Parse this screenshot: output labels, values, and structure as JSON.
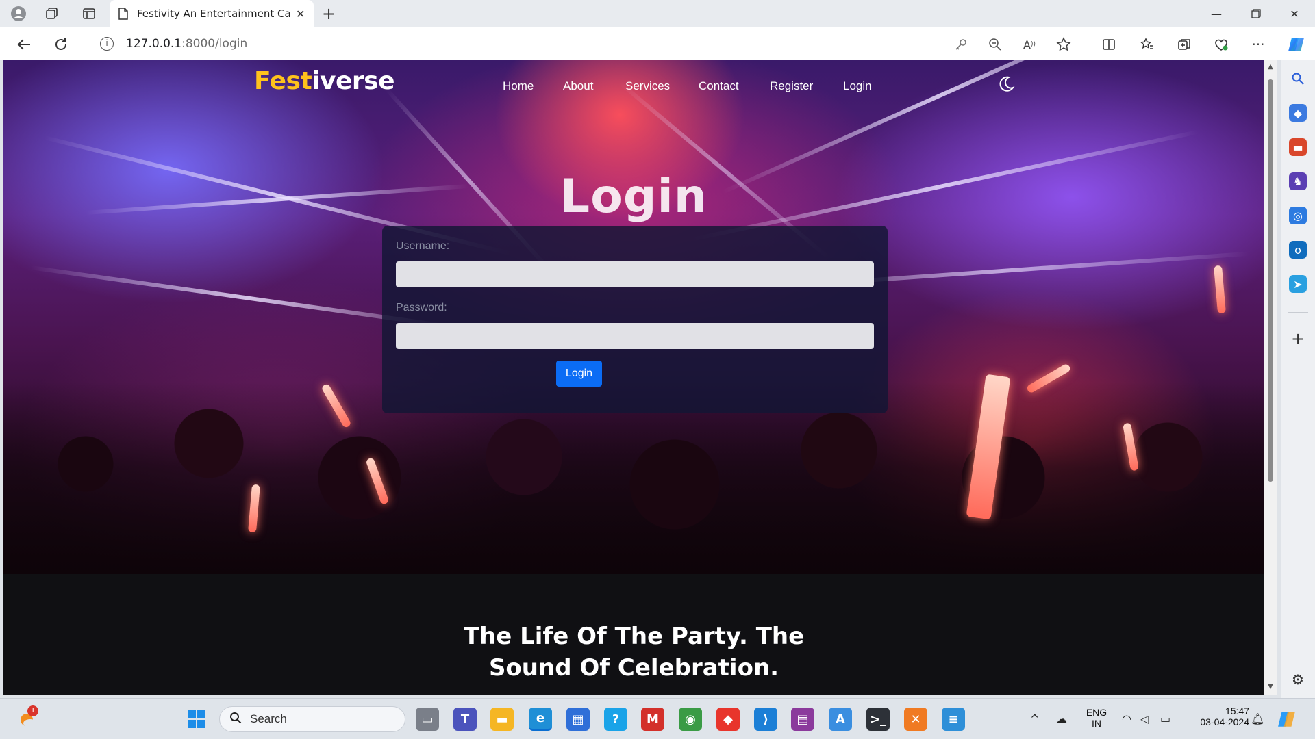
{
  "browser": {
    "tab_title": "Festivity An Entertainment Categ",
    "url_host": "127.0.0.1",
    "url_path": ":8000/login"
  },
  "site": {
    "logo_part1": "Fest",
    "logo_part2": "iverse",
    "nav": [
      "Home",
      "About",
      "Services",
      "Contact",
      "Register",
      "Login"
    ]
  },
  "login": {
    "title": "Login",
    "username_label": "Username:",
    "password_label": "Password:",
    "username_value": "",
    "password_value": "",
    "button_label": "Login"
  },
  "section2": {
    "tagline_line1": "The Life Of The Party. The",
    "tagline_line2": "Sound Of Celebration."
  },
  "taskbar": {
    "search_label": "Search",
    "notification_count": "1",
    "lang_line1": "ENG",
    "lang_line2": "IN",
    "time": "15:47",
    "date": "03-04-2024"
  },
  "colors": {
    "logo_accent": "#ffc21c",
    "login_button": "#0b6cf5"
  }
}
